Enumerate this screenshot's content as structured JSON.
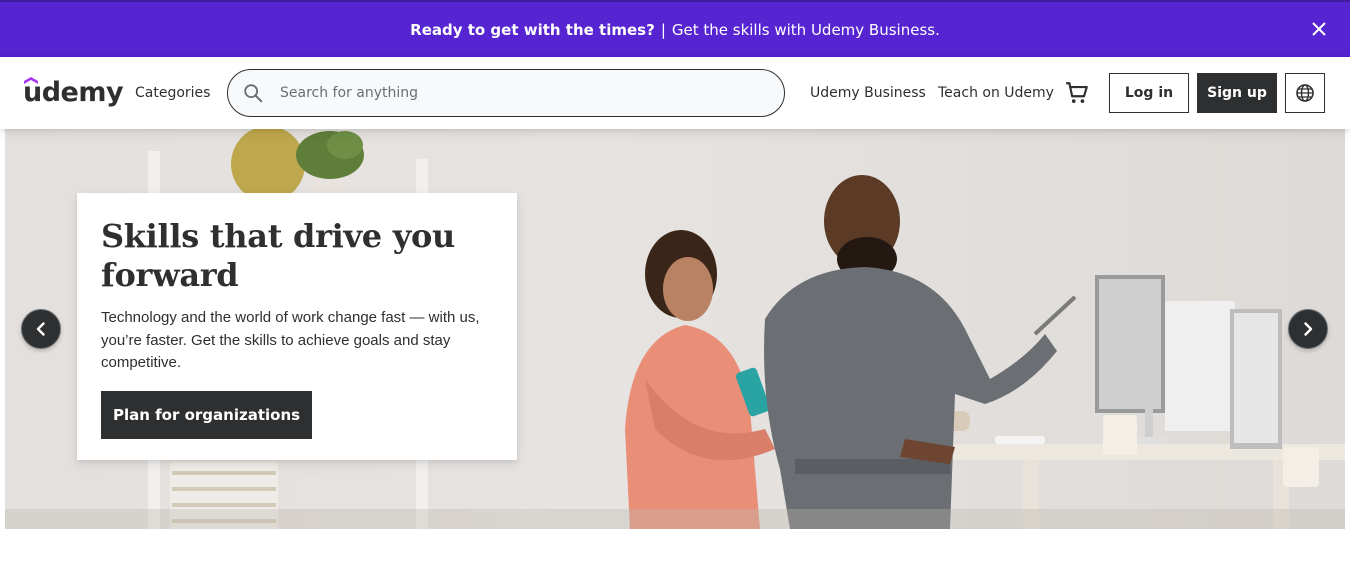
{
  "banner": {
    "bold_text": "Ready to get with the times?",
    "separator": "|",
    "text": "Get the skills with Udemy Business.",
    "background": "#5624d0"
  },
  "header": {
    "logo_text": "udemy",
    "categories_label": "Categories",
    "search_placeholder": "Search for anything",
    "udemy_business_label": "Udemy Business",
    "teach_label": "Teach on Udemy",
    "login_label": "Log in",
    "signup_label": "Sign up",
    "icons": [
      "search-icon",
      "cart-icon",
      "globe-icon",
      "close-icon"
    ]
  },
  "hero": {
    "title": "Skills that drive you forward",
    "description": "Technology and the world of work change fast — with us, you’re faster. Get the skills to achieve goals and stay competitive.",
    "cta_label": "Plan for organizations"
  },
  "colors": {
    "brand_purple": "#a435f0",
    "dark": "#2d2f31"
  }
}
